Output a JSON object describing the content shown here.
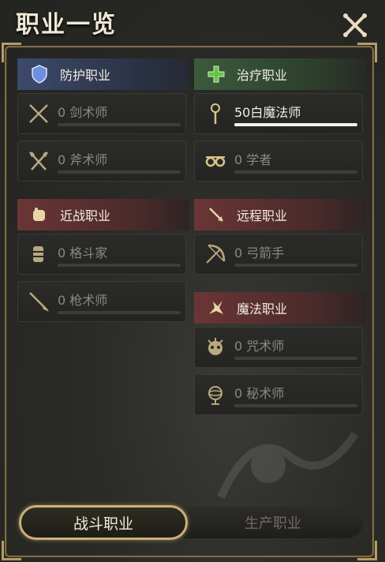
{
  "window": {
    "title": "职业一览"
  },
  "sections": {
    "tank": {
      "header": "防护职业",
      "jobs": [
        {
          "level": "0",
          "name": "剑术师",
          "progress": 0
        },
        {
          "level": "0",
          "name": "斧术师",
          "progress": 0
        }
      ]
    },
    "healer": {
      "header": "治疗职业",
      "jobs": [
        {
          "level": "50",
          "name": "白魔法师",
          "progress": 1.0
        },
        {
          "level": "0",
          "name": "学者",
          "progress": 0
        }
      ]
    },
    "melee": {
      "header": "近战职业",
      "jobs": [
        {
          "level": "0",
          "name": "格斗家",
          "progress": 0
        },
        {
          "level": "0",
          "name": "枪术师",
          "progress": 0
        }
      ]
    },
    "ranged": {
      "header": "远程职业",
      "jobs": [
        {
          "level": "0",
          "name": "弓箭手",
          "progress": 0
        }
      ]
    },
    "magic": {
      "header": "魔法职业",
      "jobs": [
        {
          "level": "0",
          "name": "咒术师",
          "progress": 0
        },
        {
          "level": "0",
          "name": "秘术师",
          "progress": 0
        }
      ]
    }
  },
  "tabs": {
    "combat": "战斗职业",
    "crafting": "生产职业"
  },
  "colors": {
    "tank": "#3d4a6b",
    "healer": "#3c5a3b",
    "dps": "#6b3535",
    "accent_gold": "#c9b07a"
  },
  "icons": {
    "close": "crossed-swords-close-icon",
    "tank": "shield-icon",
    "healer": "green-cross-icon",
    "melee": "fist-icon",
    "ranged": "arrow-icon",
    "magic": "magic-burst-icon"
  }
}
